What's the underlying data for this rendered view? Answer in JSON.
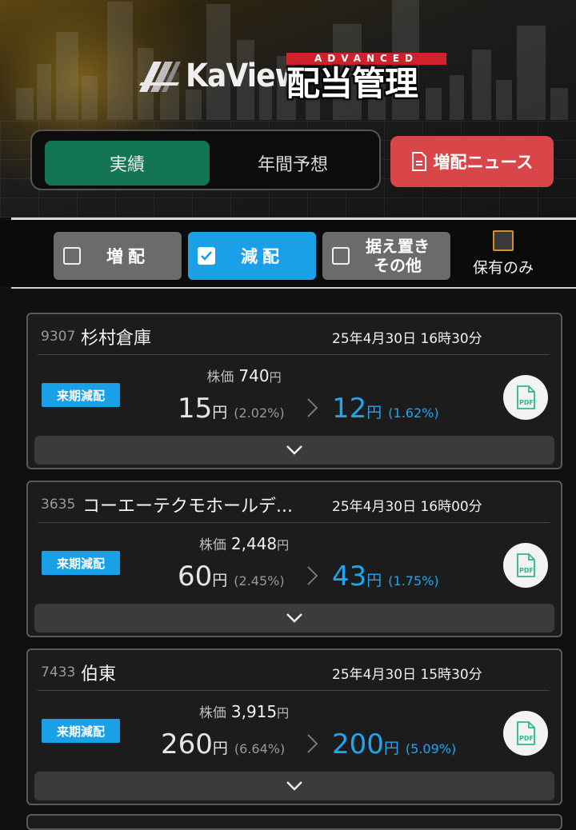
{
  "header": {
    "logo_text": "KaView",
    "advanced_tag": "ADVANCED",
    "title": "配当管理",
    "tabs": [
      {
        "label": "実績",
        "active": true
      },
      {
        "label": "年間予想",
        "active": false
      }
    ],
    "news_button": "増配ニュース"
  },
  "filters": {
    "chips": [
      {
        "label": "増配",
        "checked": false
      },
      {
        "label": "減配",
        "checked": true
      },
      {
        "label_line1": "据え置き",
        "label_line2": "その他",
        "checked": false
      }
    ],
    "owned_only": {
      "label": "保有のみ",
      "checked": false
    }
  },
  "cards": [
    {
      "code": "9307",
      "name": "杉村倉庫",
      "datetime": "25年4月30日 16時30分",
      "badge": "来期減配",
      "price_label": "株価",
      "price": "740",
      "yen": "円",
      "old_dividend": "15",
      "old_yield": "(2.02%)",
      "new_dividend": "12",
      "new_yield": "(1.62%)"
    },
    {
      "code": "3635",
      "name": "コーエーテクモホールデ...",
      "datetime": "25年4月30日 16時00分",
      "badge": "来期減配",
      "price_label": "株価",
      "price": "2,448",
      "yen": "円",
      "old_dividend": "60",
      "old_yield": "(2.45%)",
      "new_dividend": "43",
      "new_yield": "(1.75%)"
    },
    {
      "code": "7433",
      "name": "伯東",
      "datetime": "25年4月30日 15時30分",
      "badge": "来期減配",
      "price_label": "株価",
      "price": "3,915",
      "yen": "円",
      "old_dividend": "260",
      "old_yield": "(6.64%)",
      "new_dividend": "200",
      "new_yield": "(5.09%)"
    }
  ],
  "icons": {
    "pdf": "pdf-file-icon",
    "expand": "chevron-down-icon",
    "news": "document-icon",
    "check": "check-icon"
  },
  "colors": {
    "accent_blue": "#1aa0e6",
    "tab_green": "#137556",
    "news_red": "#d9464a"
  }
}
